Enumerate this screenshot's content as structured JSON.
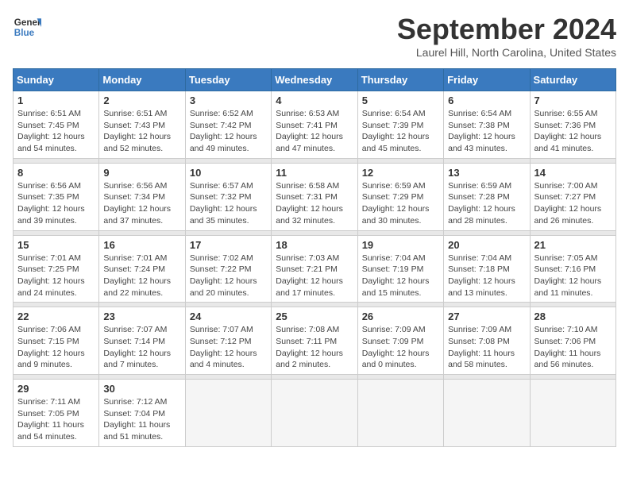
{
  "header": {
    "logo_line1": "General",
    "logo_line2": "Blue",
    "month_title": "September 2024",
    "location": "Laurel Hill, North Carolina, United States"
  },
  "weekdays": [
    "Sunday",
    "Monday",
    "Tuesday",
    "Wednesday",
    "Thursday",
    "Friday",
    "Saturday"
  ],
  "weeks": [
    [
      {
        "day": "1",
        "sunrise": "6:51 AM",
        "sunset": "7:45 PM",
        "daylight": "12 hours and 54 minutes."
      },
      {
        "day": "2",
        "sunrise": "6:51 AM",
        "sunset": "7:43 PM",
        "daylight": "12 hours and 52 minutes."
      },
      {
        "day": "3",
        "sunrise": "6:52 AM",
        "sunset": "7:42 PM",
        "daylight": "12 hours and 49 minutes."
      },
      {
        "day": "4",
        "sunrise": "6:53 AM",
        "sunset": "7:41 PM",
        "daylight": "12 hours and 47 minutes."
      },
      {
        "day": "5",
        "sunrise": "6:54 AM",
        "sunset": "7:39 PM",
        "daylight": "12 hours and 45 minutes."
      },
      {
        "day": "6",
        "sunrise": "6:54 AM",
        "sunset": "7:38 PM",
        "daylight": "12 hours and 43 minutes."
      },
      {
        "day": "7",
        "sunrise": "6:55 AM",
        "sunset": "7:36 PM",
        "daylight": "12 hours and 41 minutes."
      }
    ],
    [
      {
        "day": "8",
        "sunrise": "6:56 AM",
        "sunset": "7:35 PM",
        "daylight": "12 hours and 39 minutes."
      },
      {
        "day": "9",
        "sunrise": "6:56 AM",
        "sunset": "7:34 PM",
        "daylight": "12 hours and 37 minutes."
      },
      {
        "day": "10",
        "sunrise": "6:57 AM",
        "sunset": "7:32 PM",
        "daylight": "12 hours and 35 minutes."
      },
      {
        "day": "11",
        "sunrise": "6:58 AM",
        "sunset": "7:31 PM",
        "daylight": "12 hours and 32 minutes."
      },
      {
        "day": "12",
        "sunrise": "6:59 AM",
        "sunset": "7:29 PM",
        "daylight": "12 hours and 30 minutes."
      },
      {
        "day": "13",
        "sunrise": "6:59 AM",
        "sunset": "7:28 PM",
        "daylight": "12 hours and 28 minutes."
      },
      {
        "day": "14",
        "sunrise": "7:00 AM",
        "sunset": "7:27 PM",
        "daylight": "12 hours and 26 minutes."
      }
    ],
    [
      {
        "day": "15",
        "sunrise": "7:01 AM",
        "sunset": "7:25 PM",
        "daylight": "12 hours and 24 minutes."
      },
      {
        "day": "16",
        "sunrise": "7:01 AM",
        "sunset": "7:24 PM",
        "daylight": "12 hours and 22 minutes."
      },
      {
        "day": "17",
        "sunrise": "7:02 AM",
        "sunset": "7:22 PM",
        "daylight": "12 hours and 20 minutes."
      },
      {
        "day": "18",
        "sunrise": "7:03 AM",
        "sunset": "7:21 PM",
        "daylight": "12 hours and 17 minutes."
      },
      {
        "day": "19",
        "sunrise": "7:04 AM",
        "sunset": "7:19 PM",
        "daylight": "12 hours and 15 minutes."
      },
      {
        "day": "20",
        "sunrise": "7:04 AM",
        "sunset": "7:18 PM",
        "daylight": "12 hours and 13 minutes."
      },
      {
        "day": "21",
        "sunrise": "7:05 AM",
        "sunset": "7:16 PM",
        "daylight": "12 hours and 11 minutes."
      }
    ],
    [
      {
        "day": "22",
        "sunrise": "7:06 AM",
        "sunset": "7:15 PM",
        "daylight": "12 hours and 9 minutes."
      },
      {
        "day": "23",
        "sunrise": "7:07 AM",
        "sunset": "7:14 PM",
        "daylight": "12 hours and 7 minutes."
      },
      {
        "day": "24",
        "sunrise": "7:07 AM",
        "sunset": "7:12 PM",
        "daylight": "12 hours and 4 minutes."
      },
      {
        "day": "25",
        "sunrise": "7:08 AM",
        "sunset": "7:11 PM",
        "daylight": "12 hours and 2 minutes."
      },
      {
        "day": "26",
        "sunrise": "7:09 AM",
        "sunset": "7:09 PM",
        "daylight": "12 hours and 0 minutes."
      },
      {
        "day": "27",
        "sunrise": "7:09 AM",
        "sunset": "7:08 PM",
        "daylight": "11 hours and 58 minutes."
      },
      {
        "day": "28",
        "sunrise": "7:10 AM",
        "sunset": "7:06 PM",
        "daylight": "11 hours and 56 minutes."
      }
    ],
    [
      {
        "day": "29",
        "sunrise": "7:11 AM",
        "sunset": "7:05 PM",
        "daylight": "11 hours and 54 minutes."
      },
      {
        "day": "30",
        "sunrise": "7:12 AM",
        "sunset": "7:04 PM",
        "daylight": "11 hours and 51 minutes."
      },
      null,
      null,
      null,
      null,
      null
    ]
  ]
}
